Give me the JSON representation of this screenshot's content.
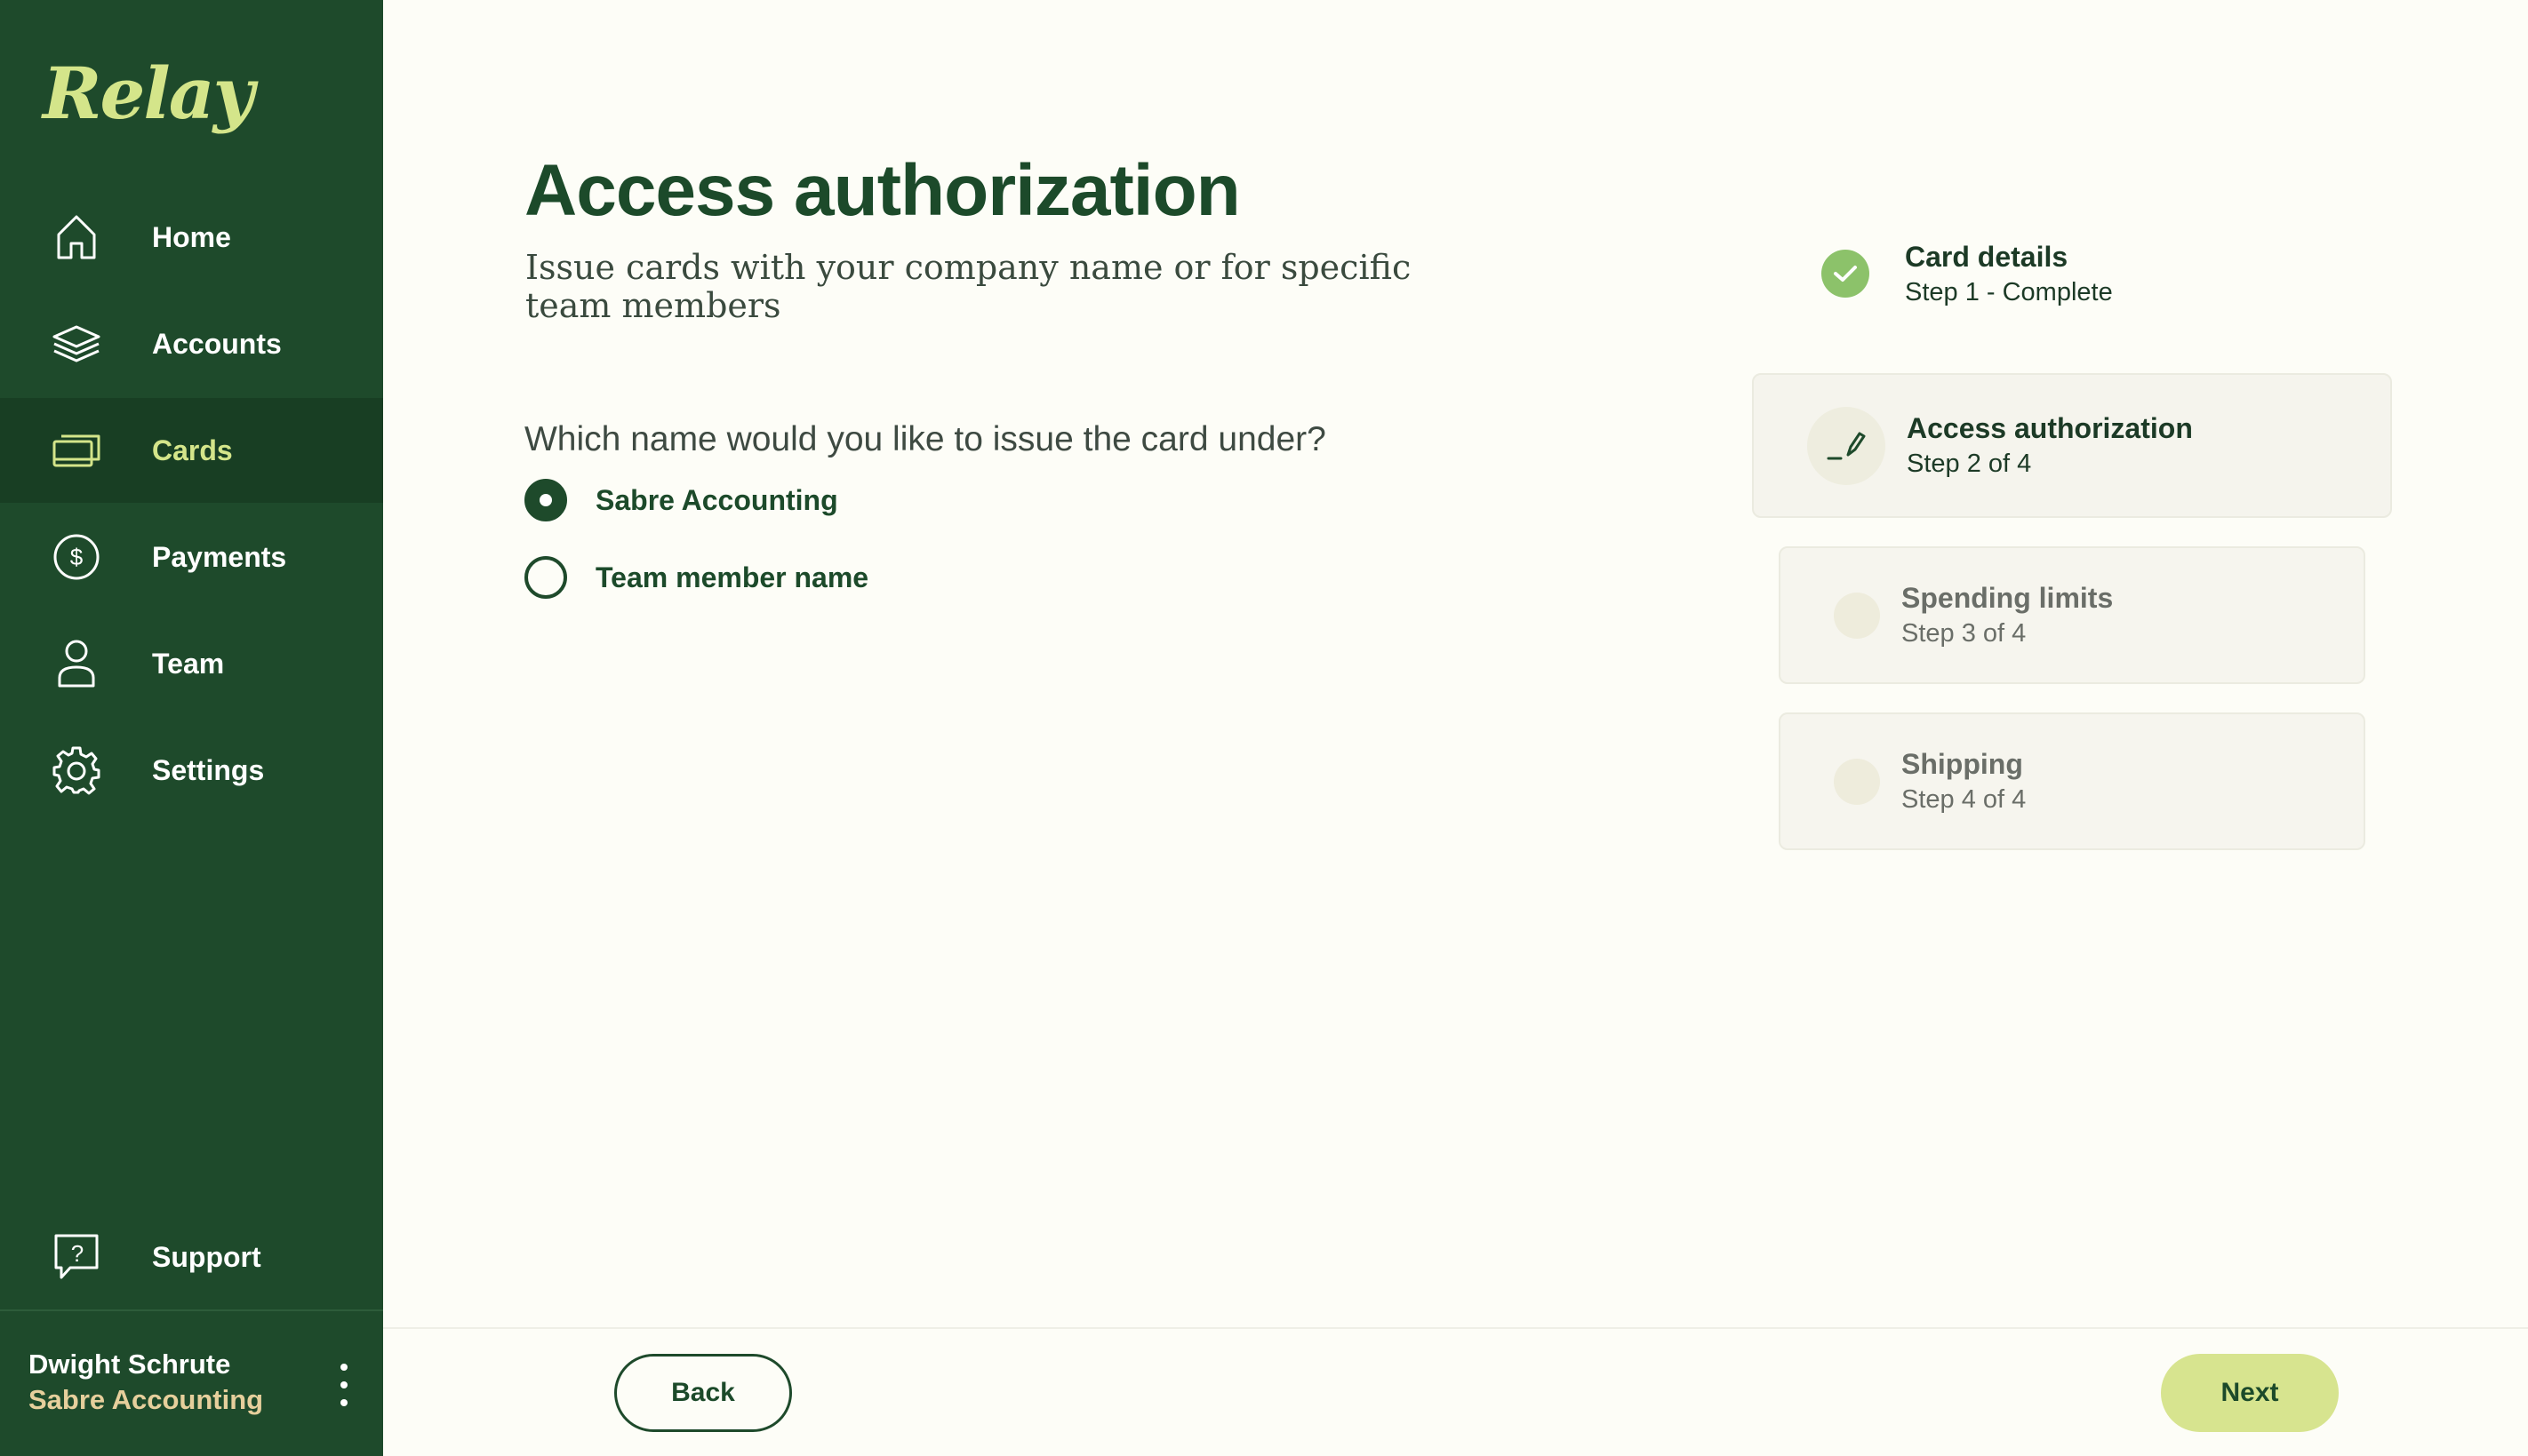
{
  "app": {
    "logo": "Relay"
  },
  "sidebar": {
    "items": [
      {
        "label": "Home",
        "icon": "home-icon",
        "active": false
      },
      {
        "label": "Accounts",
        "icon": "layers-icon",
        "active": false
      },
      {
        "label": "Cards",
        "icon": "card-icon",
        "active": true
      },
      {
        "label": "Payments",
        "icon": "dollar-icon",
        "active": false
      },
      {
        "label": "Team",
        "icon": "person-icon",
        "active": false
      },
      {
        "label": "Settings",
        "icon": "gear-icon",
        "active": false
      }
    ],
    "support": {
      "label": "Support",
      "icon": "help-icon"
    },
    "user": {
      "name": "Dwight Schrute",
      "org": "Sabre Accounting"
    }
  },
  "main": {
    "title": "Access authorization",
    "subtitle": "Issue cards with your company name or for specific team members",
    "question": "Which name would you like to issue the card under?",
    "options": [
      {
        "label": "Sabre Accounting",
        "selected": true
      },
      {
        "label": "Team member name",
        "selected": false
      }
    ]
  },
  "steps": [
    {
      "title": "Card details",
      "subtitle": "Step 1 - Complete",
      "state": "complete"
    },
    {
      "title": "Access authorization",
      "subtitle": "Step 2 of 4",
      "state": "current"
    },
    {
      "title": "Spending limits",
      "subtitle": "Step 3 of 4",
      "state": "upcoming"
    },
    {
      "title": "Shipping",
      "subtitle": "Step 4 of 4",
      "state": "upcoming"
    }
  ],
  "footer": {
    "back_label": "Back",
    "next_label": "Next"
  },
  "colors": {
    "sidebar_bg": "#1e4a2b",
    "accent": "#d4e58a",
    "page_bg": "#fdfdf7",
    "success": "#8cc26a"
  }
}
